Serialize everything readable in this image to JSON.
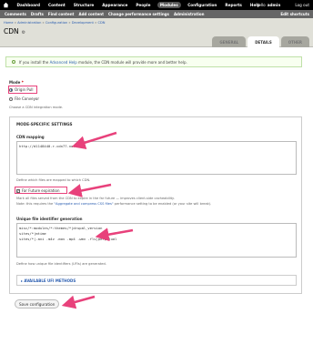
{
  "toolbar": {
    "items": [
      "Dashboard",
      "Content",
      "Structure",
      "Appearance",
      "People",
      "Modules",
      "Configuration",
      "Reports",
      "Help"
    ],
    "active_index": 5,
    "hello_prefix": "Hello",
    "username": "admin",
    "logout": "Log out"
  },
  "shortcuts": {
    "items": [
      "Comments",
      "Drafts",
      "Find content",
      "Add content",
      "Change performance settings",
      "Administration"
    ],
    "edit": "Edit shortcuts"
  },
  "header": {
    "breadcrumb": [
      "Home",
      "Administration",
      "Configuration",
      "Development",
      "CDN"
    ],
    "title": "CDN",
    "tabs": [
      "GENERAL",
      "DETAILS",
      "OTHER"
    ],
    "active_tab": 1
  },
  "notice": {
    "prefix": "If you install the",
    "link": "Advanced Help",
    "suffix": "module, the CDN module will provide more and better help."
  },
  "mode": {
    "label": "Mode",
    "required": "*",
    "options": [
      "Origin Pull",
      "File Conveyor"
    ],
    "selected": 0,
    "description": "Choose a CDN integration mode."
  },
  "mode_settings": {
    "legend": "MODE-SPECIFIC SETTINGS",
    "cdn_mapping_label": "CDN mapping",
    "cdn_mapping_value": "http://d1148440.r.cdn77.net",
    "cdn_mapping_desc": "Define which files are mapped to which CDN.",
    "far_future_label": "Far Future expiration",
    "far_future_checked": true,
    "far_future_desc_1": "Mark all files served from the CDN to expire in the far future — improves client-side cacheability.",
    "far_future_desc_2_prefix": "Note: this requires the",
    "far_future_desc_2_link": "\"Aggregate and compress CSS files\"",
    "far_future_desc_2_suffix": "performance setting to be enabled (or your site will break).",
    "ufi_label": "Unique file identifier generation",
    "ufi_lines": [
      "misc/*:modules/*:themes/*|drupal_version",
      "sites/*|mtime",
      "sites/*|.avi .m4v .mov .mp4 .wmv .flv|perpetual"
    ],
    "ufi_desc": "Define how unique file identifiers (UFIs) are generated.",
    "advanced_ufi": "▸ AVAILABLE UFI METHODS"
  },
  "save_button": "Save configuration",
  "colors": {
    "annotation": "#e8417b",
    "link": "#2a5db0",
    "toolbar": "#000000",
    "shortcut_bar": "#666666",
    "header_bg": "#e0e0d8"
  }
}
